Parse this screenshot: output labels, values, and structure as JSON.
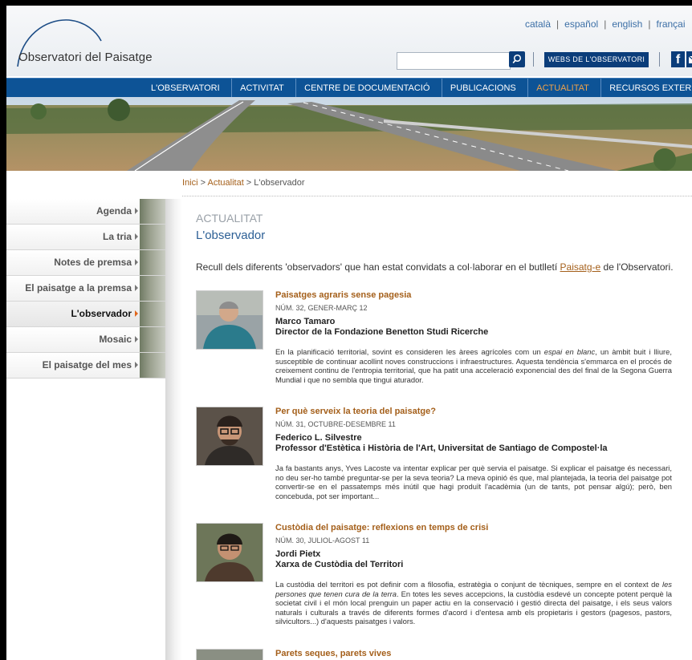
{
  "header": {
    "logo_text": "Observatori del Paisatge",
    "languages": [
      "català",
      "español",
      "english",
      "françai"
    ],
    "search_placeholder": "",
    "webs_button": "WEBS DE L'OBSERVATORI",
    "facebook_glyph": "f"
  },
  "nav": {
    "items": [
      "L'OBSERVATORI",
      "ACTIVITAT",
      "CENTRE DE DOCUMENTACIÓ",
      "PUBLICACIONS",
      "ACTUALITAT",
      "RECURSOS EXTERNS"
    ],
    "active": "ACTUALITAT"
  },
  "breadcrumb": {
    "home": "Inici",
    "sep": " > ",
    "section": "Actualitat",
    "current": "L'observador"
  },
  "sidebar": {
    "items": [
      "Agenda",
      "La tria",
      "Notes de premsa",
      "El paisatge a la premsa",
      "L'observador",
      "Mosaic",
      "El paisatge del mes"
    ],
    "active": "L'observador"
  },
  "content": {
    "section_title": "ACTUALITAT",
    "page_title": "L'observador",
    "intro_before": "Recull dels diferents 'observadors' que han estat convidats a col·laborar en el butlletí ",
    "intro_link": "Paisatg-e",
    "intro_after": " de l'Observatori."
  },
  "entries": [
    {
      "title": "Paisatges agraris sense pagesia",
      "issue": "NÚM. 32, GENER-MARÇ 12",
      "author": "Marco Tamaro",
      "role": "Director de la Fondazione Benetton Studi Ricerche",
      "desc_a": "En la planificació territorial, sovint es consideren les àrees agrícoles com un ",
      "desc_em": "espai en blanc",
      "desc_b": ", un àmbit buit i lliure, susceptible de continuar acollint noves construccions i infraestructures. Aquesta tendència s'emmarca en el procés de creixement continu de l'entropia territorial, que ha patit una acceleració exponencial des del final de la Segona Guerra Mundial i que no sembla que tingui aturador."
    },
    {
      "title": "Per què serveix la teoria del paisatge?",
      "issue": "NÚM. 31, OCTUBRE-DESEMBRE 11",
      "author": "Federico L. Silvestre",
      "role": "Professor d'Estètica i Història de l'Art, Universitat de Santiago de Compostel·la",
      "desc_a": "Ja fa bastants anys, Yves Lacoste va intentar explicar per què servia el paisatge. Si explicar el paisatge és necessari, no deu ser-ho també preguntar-se per la seva teoria? La meva opinió és que, mal plantejada, la teoria del paisatge pot convertir-se en el passatemps més inútil que hagi produït l'acadèmia (un de tants, pot pensar algú); però, ben concebuda, pot ser important...",
      "desc_em": "",
      "desc_b": ""
    },
    {
      "title": "Custòdia del paisatge: reflexions en temps de crisi",
      "issue": "NÚM. 30, JULIOL-AGOST 11",
      "author": "Jordi Pietx",
      "role": "Xarxa de Custòdia del Territori",
      "desc_a": "La custòdia del territori es pot definir com a filosofia, estratègia o conjunt de tècniques, sempre en el context de ",
      "desc_em": "les persones que tenen cura de la terra",
      "desc_b": ". En totes les seves accepcions, la custòdia esdevé un concepte potent perquè la societat civil i el món local prenguin un paper actiu en la conservació i gestió directa del paisatge, i els seus valors naturals i culturals a través de diferents formes d'acord i d'entesa amb els propietaris i gestors (pagesos, pastors, silvicultors...) d'aquests paisatges i valors."
    },
    {
      "title": "Parets seques, parets vives",
      "issue": "",
      "author": "",
      "role": "",
      "desc_a": "",
      "desc_em": "",
      "desc_b": ""
    }
  ]
}
